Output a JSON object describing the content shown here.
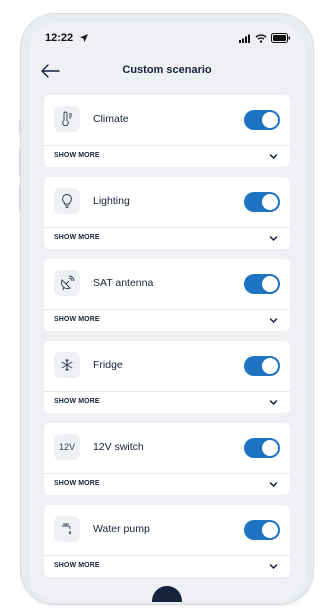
{
  "status_bar": {
    "time": "12:22"
  },
  "header": {
    "title": "Custom scenario"
  },
  "cards": [
    {
      "label": "Climate",
      "icon": "thermometer-icon",
      "toggle_on": true,
      "show_more": "SHOW MORE"
    },
    {
      "label": "Lighting",
      "icon": "lightbulb-icon",
      "toggle_on": true,
      "show_more": "SHOW MORE"
    },
    {
      "label": "SAT antenna",
      "icon": "satellite-dish-icon",
      "toggle_on": true,
      "show_more": "SHOW MORE"
    },
    {
      "label": "Fridge",
      "icon": "snowflake-icon",
      "toggle_on": true,
      "show_more": "SHOW MORE"
    },
    {
      "label": "12V switch",
      "icon_text": "12V",
      "toggle_on": true,
      "show_more": "SHOW MORE"
    },
    {
      "label": "Water pump",
      "icon": "water-tap-icon",
      "toggle_on": true,
      "show_more": "SHOW MORE"
    }
  ],
  "colors": {
    "accent": "#1e73c3",
    "text_dark": "#16233a",
    "screen_bg": "#eef0f4",
    "card_bg": "#ffffff"
  }
}
